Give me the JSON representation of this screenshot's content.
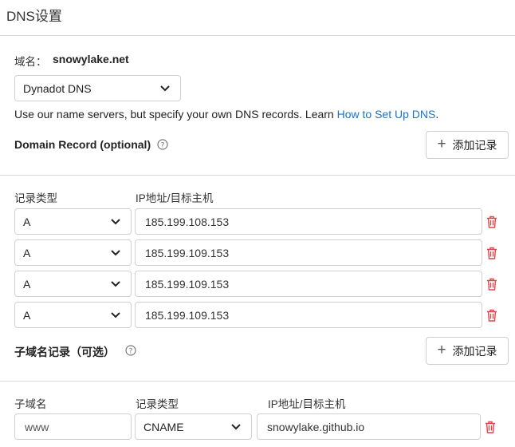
{
  "page_title": "DNS设置",
  "domain": {
    "label": "域名：",
    "value": "snowylake.net"
  },
  "dns_provider": {
    "selected": "Dynadot DNS"
  },
  "description": {
    "text": "Use our name servers, but specify your own DNS records. Learn ",
    "link": "How to Set Up DNS",
    "suffix": "."
  },
  "domain_record": {
    "title": "Domain Record (optional)",
    "add_button": "添加记录",
    "col_type": "记录类型",
    "col_ip": "IP地址/目标主机",
    "rows": [
      {
        "type": "A",
        "value": "185.199.108.153"
      },
      {
        "type": "A",
        "value": "185.199.109.153"
      },
      {
        "type": "A",
        "value": "185.199.109.153"
      },
      {
        "type": "A",
        "value": "185.199.109.153"
      }
    ]
  },
  "subdomain_record": {
    "title": "子域名记录（可选）",
    "add_button": "添加记录",
    "col_subdomain": "子域名",
    "col_type": "记录类型",
    "col_ip": "IP地址/目标主机",
    "rows": [
      {
        "subdomain": "www",
        "type": "CNAME",
        "value": "snowylake.github.io"
      }
    ]
  },
  "colors": {
    "link": "#1a73c8",
    "danger": "#e0454a",
    "border": "#d0d0d0"
  }
}
